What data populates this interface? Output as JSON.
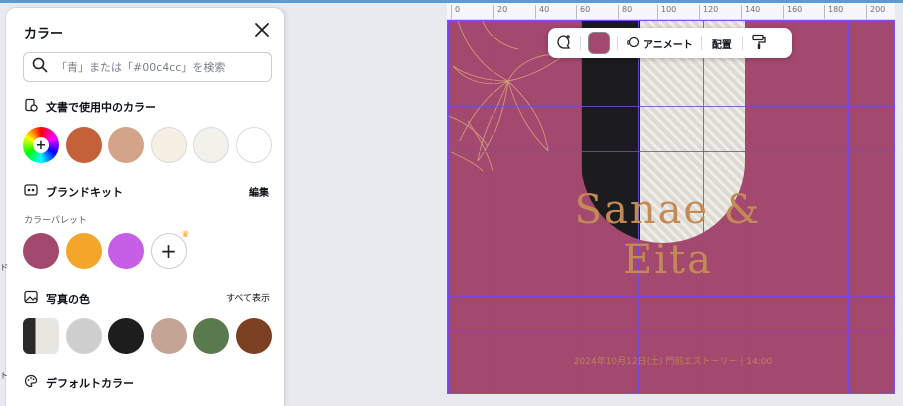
{
  "panel": {
    "title": "カラー",
    "search_placeholder": "「青」または「#00c4cc」を検索",
    "doc_colors": {
      "heading": "文書で使用中のカラー",
      "swatches": [
        "#c4613b",
        "#d4a48a",
        "#f7efe4",
        "#f2f1ea",
        "#ffffff"
      ]
    },
    "brand_kit": {
      "heading": "ブランドキット",
      "edit_label": "編集",
      "palette_label": "カラーパレット",
      "swatches": [
        "#a3486f",
        "#f4a62a",
        "#c65ee6"
      ]
    },
    "photo_colors": {
      "heading": "写真の色",
      "show_all_label": "すべて表示",
      "swatches": [
        "#cfcfcf",
        "#1d1d1d",
        "#c4a595",
        "#5a7a4d",
        "#7b3f22"
      ]
    },
    "default_colors": {
      "heading": "デフォルトカラー"
    }
  },
  "ruler": {
    "ticks": [
      "0",
      "20",
      "40",
      "60",
      "80",
      "100",
      "120",
      "140",
      "160",
      "180",
      "200"
    ]
  },
  "side_marks": [
    "ド",
    "ト"
  ],
  "canvas": {
    "background": "#a3486f",
    "name_line1": "Sanae &",
    "name_line2": "Eita",
    "date_text": "2024年10月12日(土) 門前エストーリー | 14:00"
  },
  "toolbar": {
    "animate_label": "アニメート",
    "arrange_label": "配置",
    "current_color": "#a3486f"
  },
  "colors": {
    "selection": "#7a4dff",
    "text_accent": "#c48a55",
    "top_bar": "#5b9bd5"
  }
}
